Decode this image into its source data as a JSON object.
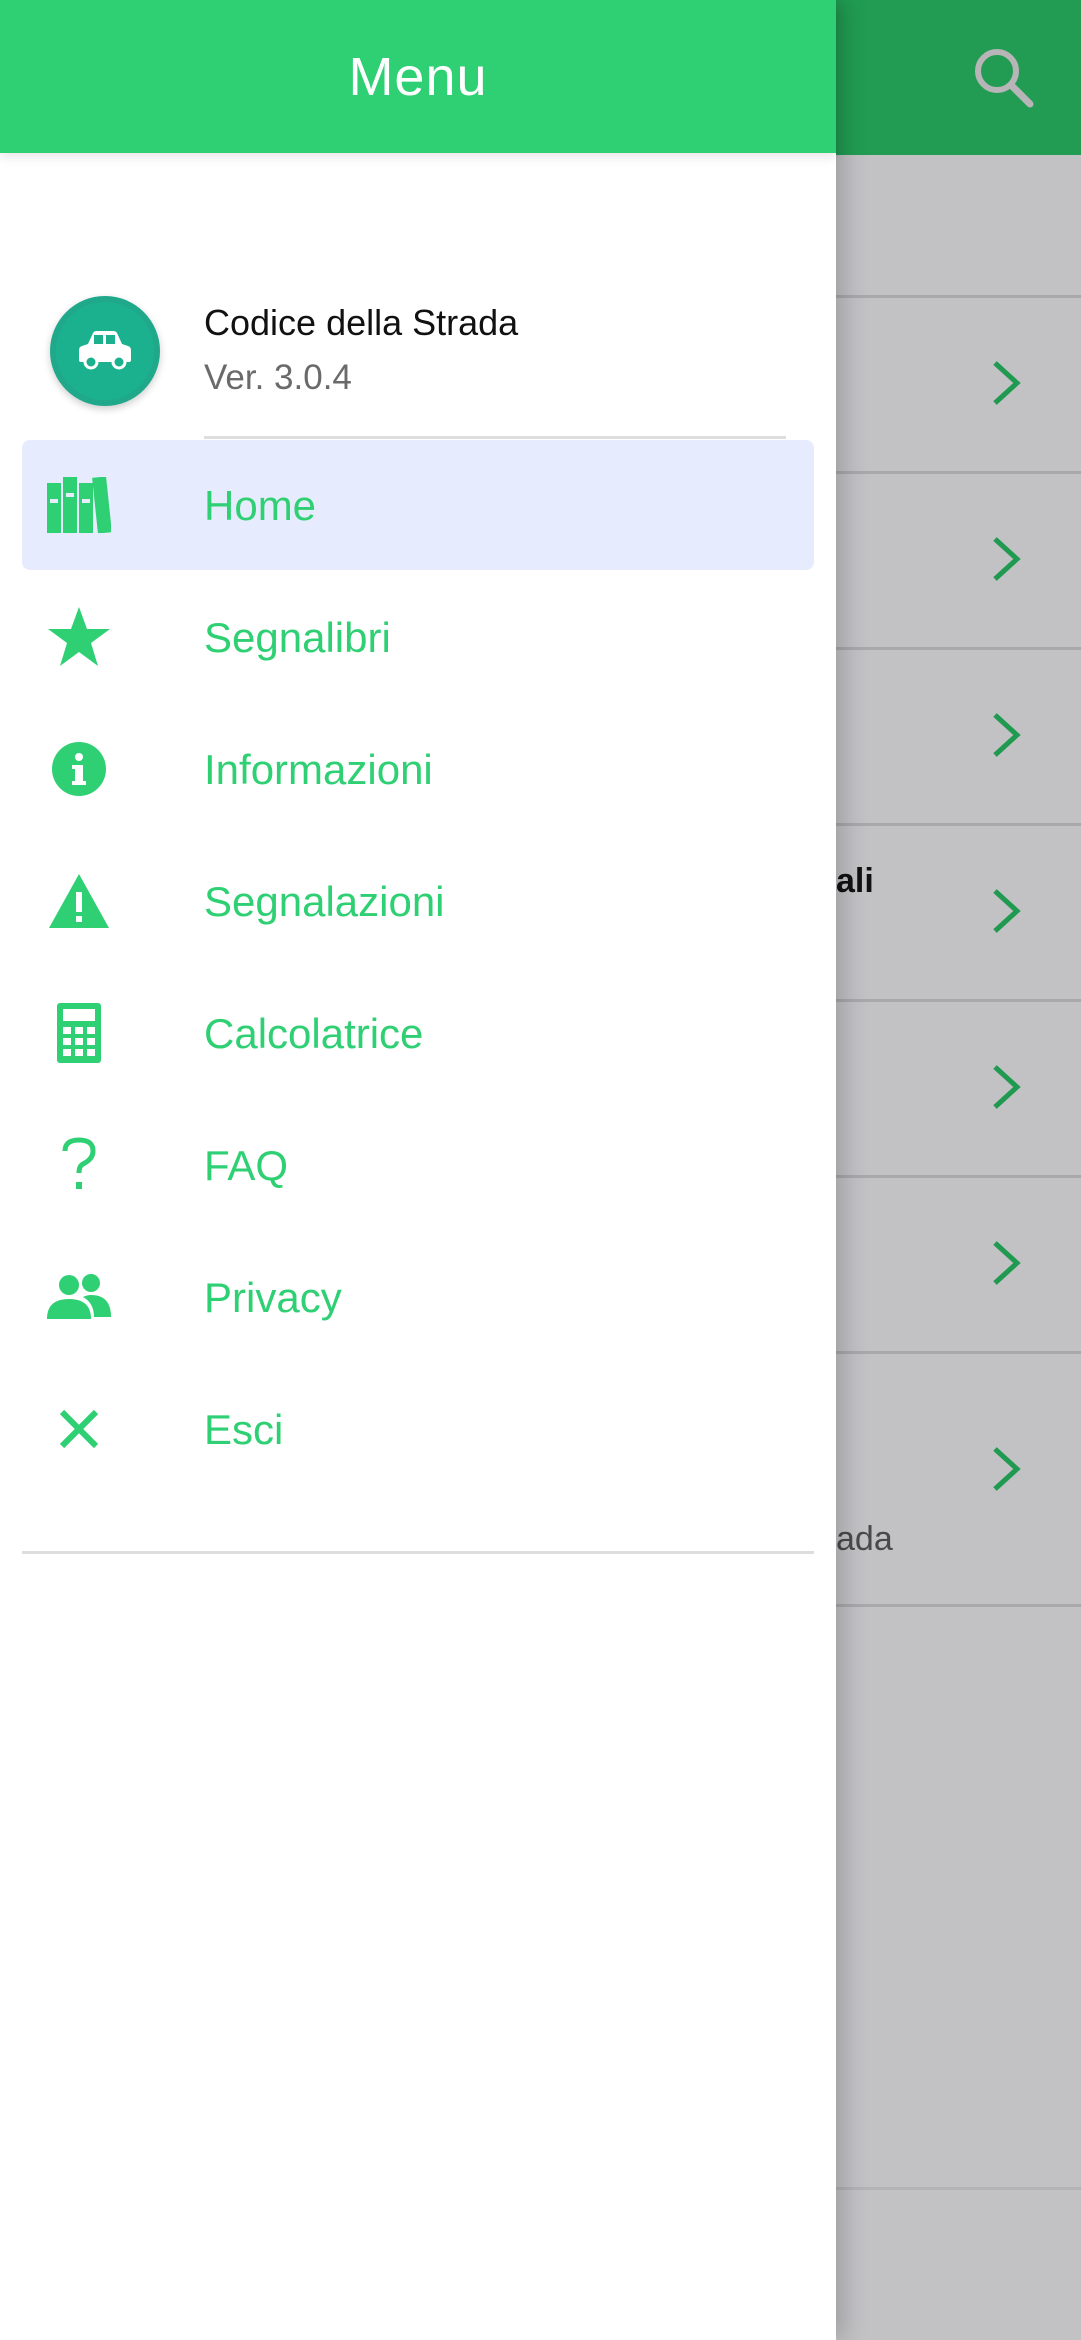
{
  "background_app": {
    "visible_texts": [
      "ali",
      "ada"
    ]
  },
  "drawer": {
    "title": "Menu",
    "app": {
      "name": "Codice della Strada",
      "version": "Ver. 3.0.4",
      "logo_icon": "car-icon"
    },
    "items": [
      {
        "label": "Home",
        "icon": "books-icon",
        "active": true
      },
      {
        "label": "Segnalibri",
        "icon": "star-icon",
        "active": false
      },
      {
        "label": "Informazioni",
        "icon": "info-icon",
        "active": false
      },
      {
        "label": "Segnalazioni",
        "icon": "warning-icon",
        "active": false
      },
      {
        "label": "Calcolatrice",
        "icon": "calculator-icon",
        "active": false
      },
      {
        "label": "FAQ",
        "icon": "question-icon",
        "active": false
      },
      {
        "label": "Privacy",
        "icon": "users-icon",
        "active": false
      },
      {
        "label": "Esci",
        "icon": "close-icon",
        "active": false
      }
    ]
  },
  "colors": {
    "drawer_header": "#2ed073",
    "app_header": "#219c52",
    "accent": "#2ed073",
    "active_item_bg": "#e6ecfd",
    "chevron": "#1f9a50"
  }
}
